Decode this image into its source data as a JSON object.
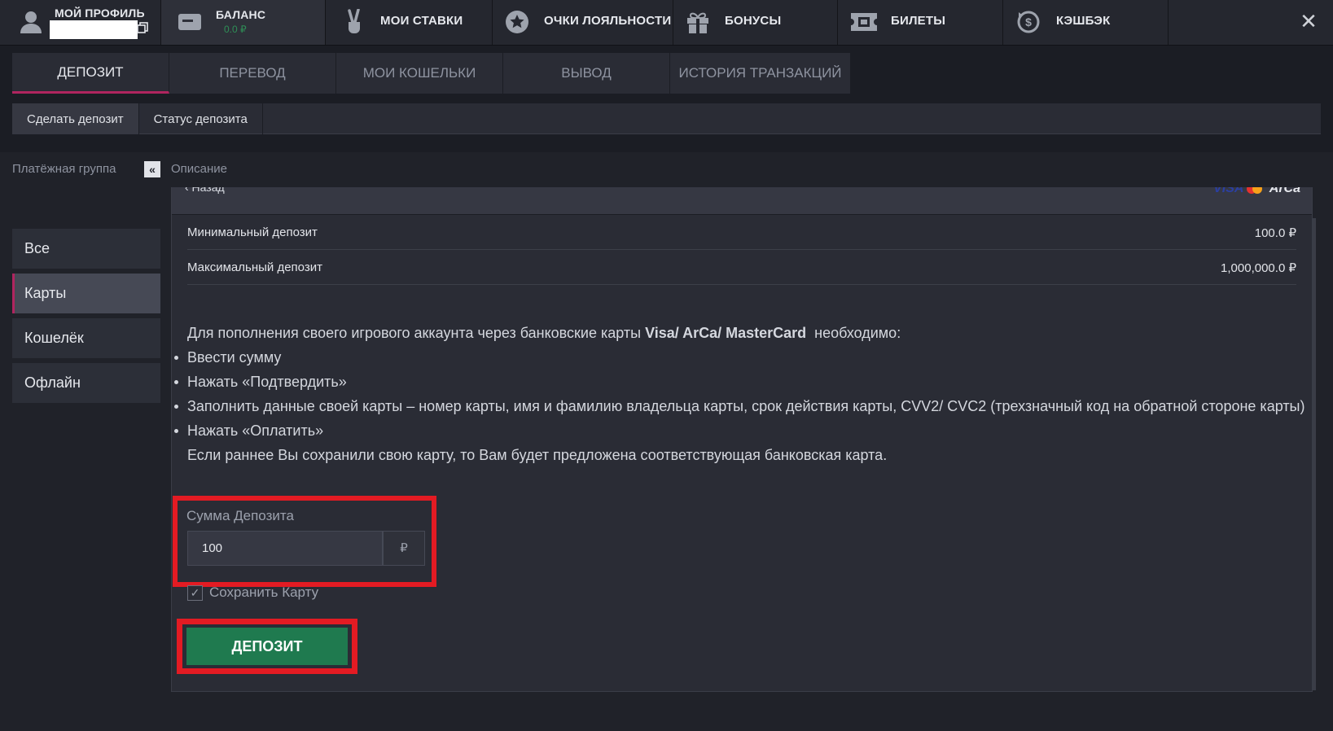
{
  "header": {
    "profile": {
      "label": "МОЙ ПРОФИЛЬ",
      "icon": "user-icon"
    },
    "balance": {
      "label": "БАЛАНС",
      "value": "0.0 ₽",
      "icon": "wallet-icon"
    },
    "bets": {
      "label": "МОИ СТАВКИ",
      "icon": "victory-hand-icon"
    },
    "loyalty": {
      "label": "ОЧКИ ЛОЯЛЬНОСТИ",
      "icon": "star-icon"
    },
    "bonuses": {
      "label": "БОНУСЫ",
      "icon": "gift-icon"
    },
    "tickets": {
      "label": "БИЛЕТЫ",
      "icon": "ticket-icon"
    },
    "cashback": {
      "label": "КЭШБЭК",
      "icon": "cashback-icon"
    },
    "close_icon": "close-icon"
  },
  "tabs": [
    "ДЕПОЗИТ",
    "ПЕРЕВОД",
    "МОИ КОШЕЛЬКИ",
    "ВЫВОД",
    "ИСТОРИЯ ТРАНЗАКЦИЙ"
  ],
  "subtabs": [
    "Сделать депозит",
    "Статус депозита"
  ],
  "sidebar": {
    "title": "Платёжная группа",
    "items": [
      "Все",
      "Карты",
      "Кошелёк",
      "Офлайн"
    ]
  },
  "panel": {
    "title": "Описание",
    "back": "‹ Назад",
    "logos": {
      "visa": "VISA",
      "arca": "ArCa"
    },
    "limits": [
      {
        "label": "Минимальный депозит",
        "value": "100.0 ₽"
      },
      {
        "label": "Максимальный депозит",
        "value": "1,000,000.0 ₽"
      }
    ],
    "info_intro_pre": "Для пополнения своего игрового аккаунта через банковские карты ",
    "info_intro_bold": "Visa/ ArCa/ MasterCard",
    "info_intro_post": "  необходимо:",
    "info_steps": [
      "Ввести сумму",
      "Нажать «Подтвердить»",
      "Заполнить данные своей карты – номер карты, имя и фамилию владельца карты, срок действия карты, CVV2/ CVC2 (трехзначный код на обратной стороне карты)",
      "Нажать «Оплатить»"
    ],
    "info_note": "Если раннее Вы сохранили свою карту, то Вам будет предложена соответствующая банковская карта.",
    "amount_label": "Сумма Депозита",
    "amount_value": "100",
    "currency": "₽",
    "save_card_label": "Сохранить Карту",
    "save_card_checked": true,
    "deposit_button": "ДЕПОЗИТ"
  },
  "colors": {
    "accent": "#b0255f",
    "button": "#1f7a4f",
    "highlight": "#e31b23"
  }
}
